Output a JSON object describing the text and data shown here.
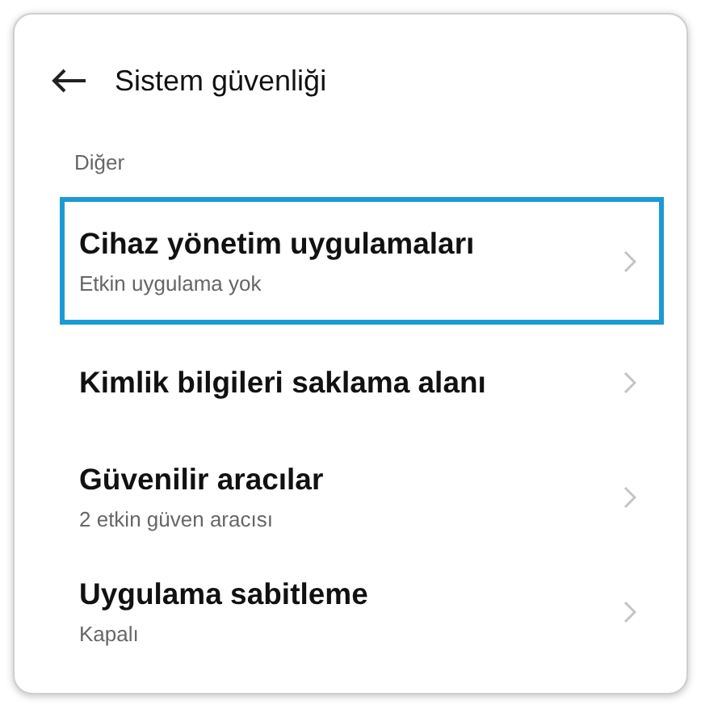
{
  "header": {
    "title": "Sistem güvenliği"
  },
  "section": {
    "title": "Diğer"
  },
  "items": [
    {
      "title": "Cihaz yönetim uygulamaları",
      "subtitle": "Etkin uygulama yok",
      "highlighted": true
    },
    {
      "title": "Kimlik bilgileri saklama alanı",
      "highlighted": false
    },
    {
      "title": "Güvenilir aracılar",
      "subtitle": "2 etkin güven aracısı",
      "highlighted": false
    },
    {
      "title": "Uygulama sabitleme",
      "subtitle": "Kapalı",
      "highlighted": false
    }
  ]
}
